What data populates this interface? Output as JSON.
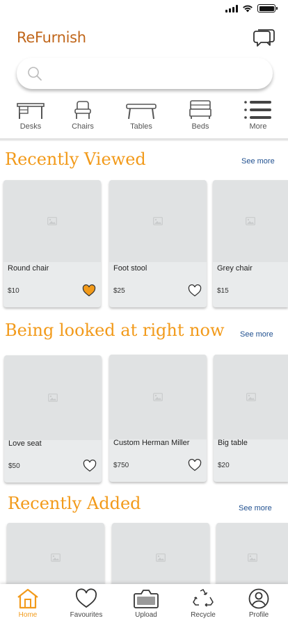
{
  "app": {
    "brand": "ReFurnish",
    "accent": "#f29a1a",
    "brand_color": "#c0661a",
    "link_color": "#1f4f8f"
  },
  "search": {
    "placeholder": ""
  },
  "categories": [
    {
      "label": "Desks",
      "icon": "desk-icon"
    },
    {
      "label": "Chairs",
      "icon": "chair-icon"
    },
    {
      "label": "Tables",
      "icon": "table-icon"
    },
    {
      "label": "Beds",
      "icon": "bed-icon"
    },
    {
      "label": "More",
      "icon": "menu-icon"
    }
  ],
  "sections": [
    {
      "title": "Recently Viewed",
      "see_more": "See more",
      "items": [
        {
          "name": "Round chair",
          "price": "$10",
          "favourited": true
        },
        {
          "name": "Foot stool",
          "price": "$25",
          "favourited": false
        },
        {
          "name": "Grey chair",
          "price": "$15",
          "favourited": false
        }
      ]
    },
    {
      "title": "Being looked at right now",
      "see_more": "See more",
      "items": [
        {
          "name": "Love seat",
          "price": "$50",
          "favourited": false
        },
        {
          "name": "Custom Herman Miller",
          "price": "$750",
          "favourited": false
        },
        {
          "name": "Big table",
          "price": "$20",
          "favourited": false
        }
      ]
    },
    {
      "title": "Recently Added",
      "see_more": "See more",
      "items": [
        {
          "name": "",
          "price": ""
        },
        {
          "name": "",
          "price": ""
        },
        {
          "name": "",
          "price": ""
        }
      ]
    }
  ],
  "bottom_nav": [
    {
      "label": "Home",
      "icon": "home-icon",
      "active": true
    },
    {
      "label": "Favourites",
      "icon": "heart-icon",
      "active": false
    },
    {
      "label": "Upload",
      "icon": "camera-icon",
      "active": false
    },
    {
      "label": "Recycle",
      "icon": "recycle-icon",
      "active": false
    },
    {
      "label": "Profile",
      "icon": "profile-icon",
      "active": false
    }
  ]
}
